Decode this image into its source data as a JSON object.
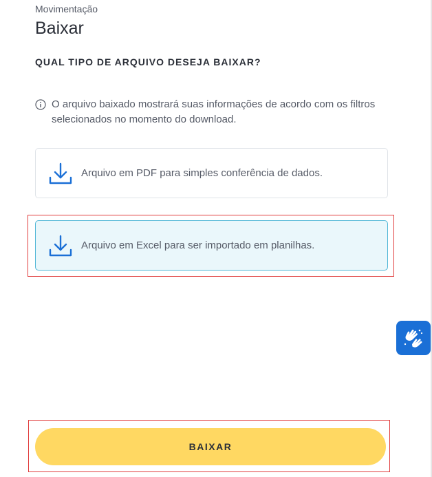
{
  "header": {
    "breadcrumb": "Movimentação",
    "title": "Baixar"
  },
  "question": "QUAL TIPO DE ARQUIVO DESEJA BAIXAR?",
  "info": {
    "icon": "info-icon",
    "text": "O arquivo baixado mostrará suas informações de acordo com os filtros selecionados no momento do download."
  },
  "options": [
    {
      "icon": "download-icon",
      "label": "Arquivo em PDF para simples conferência de dados.",
      "selected": false
    },
    {
      "icon": "download-icon",
      "label": "Arquivo em Excel para ser importado em planilhas.",
      "selected": true
    }
  ],
  "accessibility_widget": {
    "icon": "sign-language-hands-icon"
  },
  "actions": {
    "download_label": "BAIXAR"
  },
  "colors": {
    "accent_blue": "#1a6fd6",
    "selected_bg": "#eaf7fb",
    "selected_border": "#4fb6d6",
    "button_yellow": "#ffd862",
    "annotation_red": "#e03a3a",
    "text_dark": "#2b2f38",
    "text_muted": "#555a66"
  }
}
